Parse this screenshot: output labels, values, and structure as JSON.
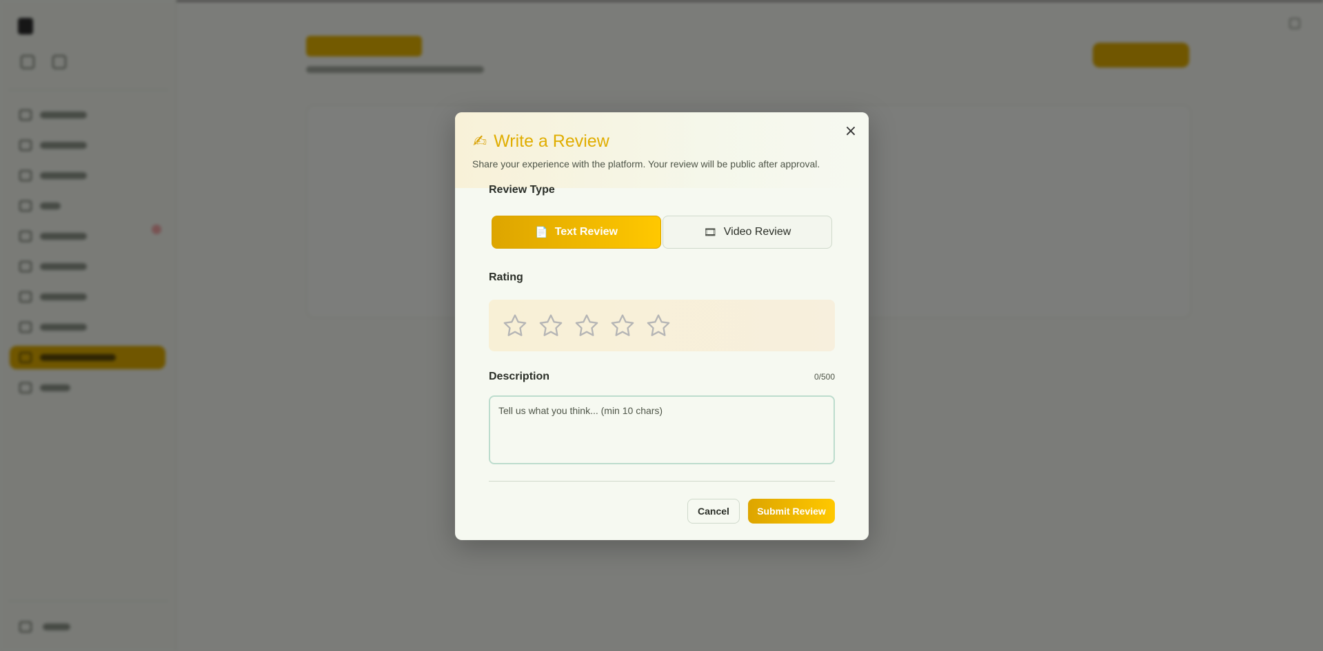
{
  "modal": {
    "title": "Write a Review",
    "title_icon": "writing-hand-icon",
    "description": "Share your experience with the platform. Your review will be public after approval.",
    "close_label": "×",
    "review_type": {
      "label": "Review Type",
      "options": [
        {
          "label": "Text Review",
          "icon": "document-icon",
          "icon_glyph": "📄",
          "selected": true
        },
        {
          "label": "Video Review",
          "icon": "film-icon",
          "icon_glyph": "🎞",
          "selected": false
        }
      ]
    },
    "rating": {
      "label": "Rating",
      "max": 5,
      "value": 0
    },
    "description_field": {
      "label": "Description",
      "value": "",
      "placeholder": "Tell us what you think... (min 10 chars)",
      "char_count": "0/500"
    },
    "buttons": {
      "cancel": "Cancel",
      "submit": "Submit Review"
    }
  },
  "colors": {
    "accent": "#e0ad00",
    "accent_light": "#ffc800",
    "overlay": "rgba(0,0,0,0.5)",
    "star_outline": "#b5b5b5"
  }
}
